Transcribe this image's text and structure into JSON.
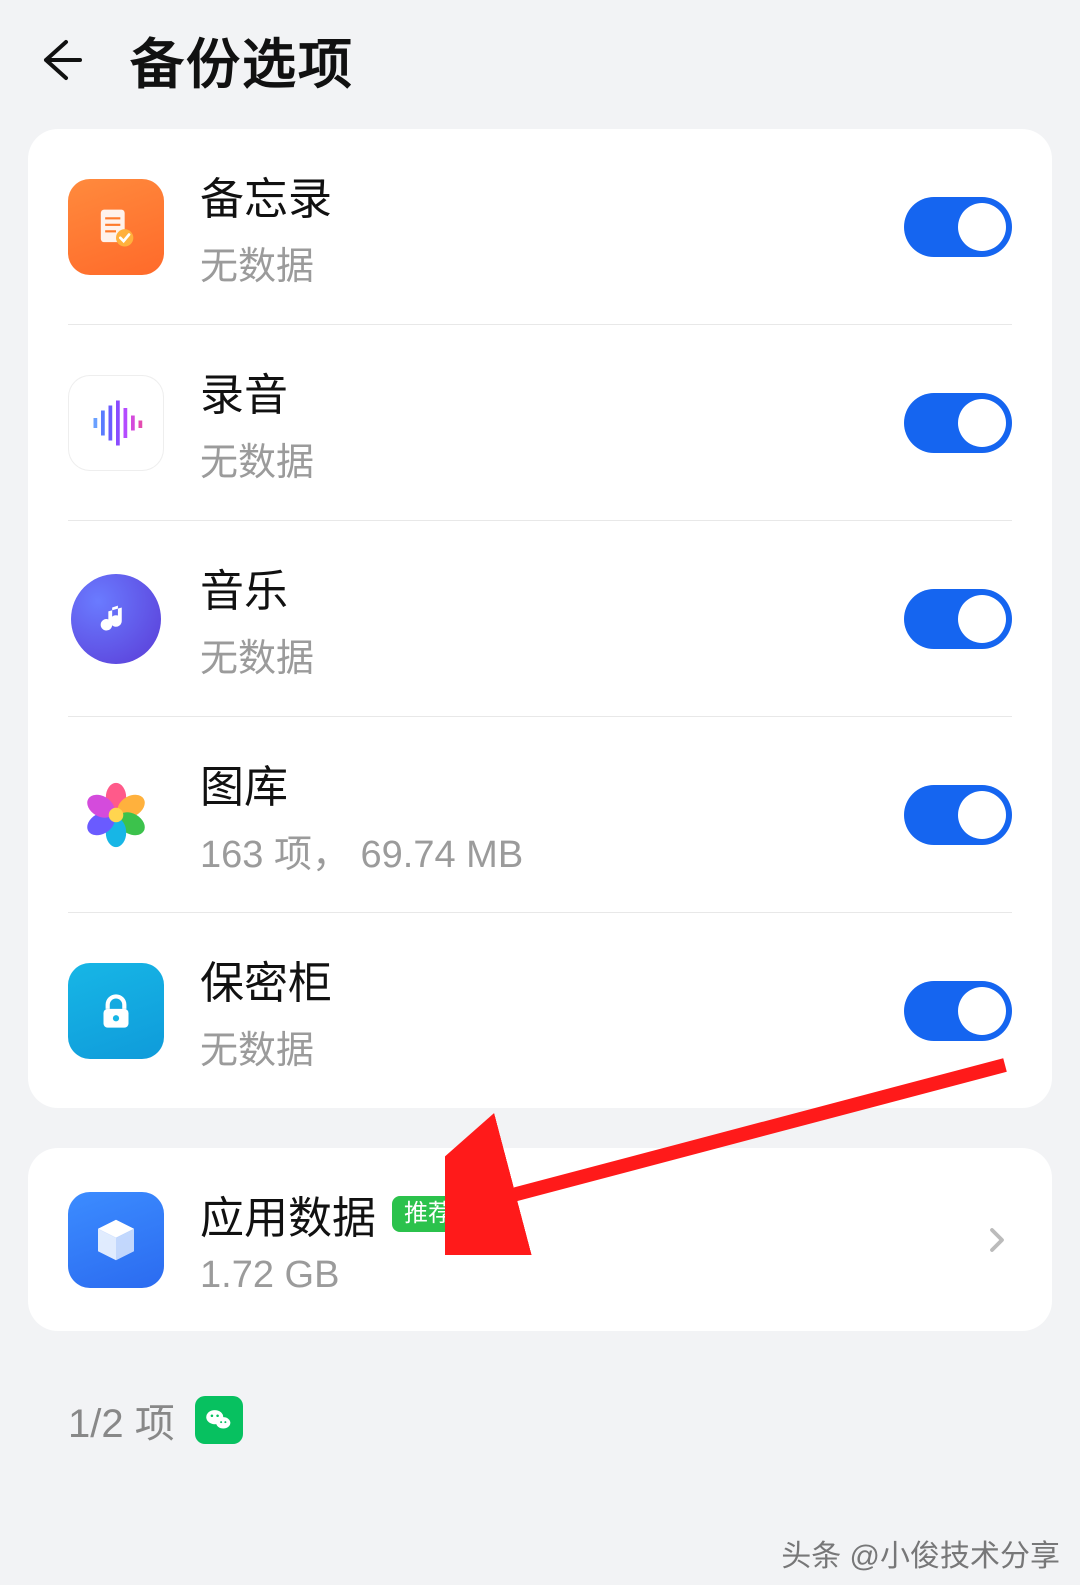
{
  "header": {
    "title": "备份选项"
  },
  "items": [
    {
      "title": "备忘录",
      "sub": "无数据",
      "toggle": true
    },
    {
      "title": "录音",
      "sub": "无数据",
      "toggle": true
    },
    {
      "title": "音乐",
      "sub": "无数据",
      "toggle": true
    },
    {
      "title": "图库",
      "sub": "163 项，  69.74 MB",
      "toggle": true
    },
    {
      "title": "保密柜",
      "sub": "无数据",
      "toggle": true
    }
  ],
  "appdata": {
    "title": "应用数据",
    "badge": "推荐开启",
    "sub": "1.72 GB"
  },
  "footer": {
    "count": "1/2 项"
  },
  "watermark": "头条 @小俊技术分享"
}
